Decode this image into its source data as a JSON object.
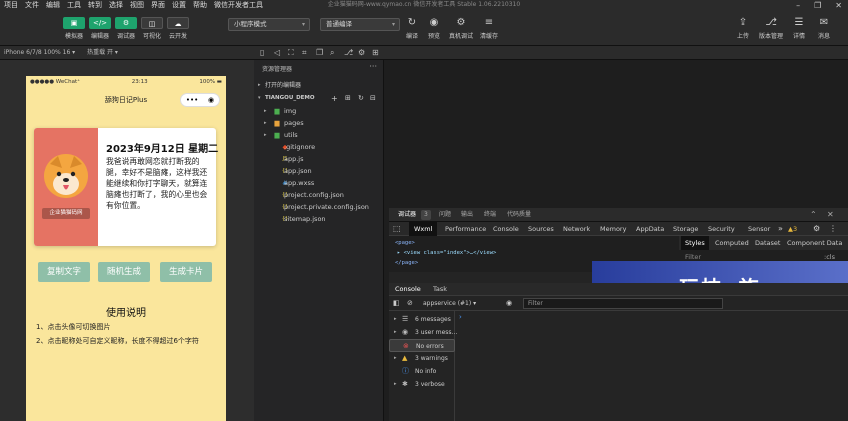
{
  "menu": [
    "项目",
    "文件",
    "编辑",
    "工具",
    "转到",
    "选择",
    "视图",
    "界面",
    "设置",
    "帮助",
    "微信开发者工具"
  ],
  "window_title": "企业猫猫码网-www.qymao.cn    微信开发者工具 Stable 1.06.2210310",
  "toolbar": {
    "buttons": [
      {
        "label": "模拟器",
        "glyph": "▣"
      },
      {
        "label": "编辑器",
        "glyph": "</>"
      },
      {
        "label": "调试器",
        "glyph": "⚙"
      },
      {
        "label": "可视化",
        "glyph": "◫"
      },
      {
        "label": "云开发",
        "glyph": "☁"
      }
    ],
    "mode_select": "小程序模式",
    "compile_select": "普通编译",
    "actions": [
      {
        "label": "编译",
        "glyph": "↻"
      },
      {
        "label": "预览",
        "glyph": "◉"
      },
      {
        "label": "真机调试",
        "glyph": "⚙"
      },
      {
        "label": "清缓存",
        "glyph": "≡"
      }
    ],
    "right_actions": [
      {
        "label": "上传",
        "glyph": "⇪"
      },
      {
        "label": "版本管理",
        "glyph": "⎇"
      },
      {
        "label": "详情",
        "glyph": "☰"
      },
      {
        "label": "消息",
        "glyph": "✉"
      }
    ]
  },
  "subbar": {
    "device": "iPhone 6/7/8 100% 16 ▾",
    "hot_reload": "热重载 开 ▾"
  },
  "phone": {
    "status_left": "●●●●● WeChat⁺",
    "time": "23:13",
    "battery": "100% ▬",
    "nav_title": "舔狗日记Plus",
    "capsule_dots": "•••",
    "capsule_target": "◉",
    "date": "2023年9月12日 星期二",
    "body": "我爸说再敢网恋就打断我的腿，幸好不是脑瘫，这样我还能继续和你打字聊天，就算连脑瘫也打断了，我的心里也会有你位置。",
    "badge": "企业猫猫码网",
    "buttons": [
      "复制文字",
      "随机生成",
      "生成卡片"
    ],
    "instructions_title": "使用说明",
    "instructions": [
      "1、点击头像可切换图片",
      "2、点击昵称处可自定义昵称，长度不得超过6个字符"
    ]
  },
  "explorer": {
    "title": "资源管理器",
    "dots": "···",
    "open_editors": "打开的编辑器",
    "project": "TIANGOU_DEMO",
    "items": [
      {
        "name": "img",
        "type": "folder",
        "icon": "▆",
        "color": "#4caf50"
      },
      {
        "name": "pages",
        "type": "folder",
        "icon": "▆",
        "color": "#e8a33d"
      },
      {
        "name": "utils",
        "type": "folder",
        "icon": "▆",
        "color": "#4caf50"
      },
      {
        "name": ".gitignore",
        "type": "file",
        "icon": "◆",
        "color": "#e44d26"
      },
      {
        "name": "app.js",
        "type": "file",
        "icon": "JS",
        "color": "#e8d44d"
      },
      {
        "name": "app.json",
        "type": "file",
        "icon": "{}",
        "color": "#e8d44d"
      },
      {
        "name": "app.wxss",
        "type": "file",
        "icon": "#",
        "color": "#42a5f5"
      },
      {
        "name": "project.config.json",
        "type": "file",
        "icon": "{}",
        "color": "#e8d44d"
      },
      {
        "name": "project.private.config.json",
        "type": "file",
        "icon": "{}",
        "color": "#e8d44d"
      },
      {
        "name": "sitemap.json",
        "type": "file",
        "icon": "{}",
        "color": "#e8d44d"
      }
    ]
  },
  "devtools": {
    "top_tabs": [
      "调试器",
      "3",
      "问题",
      "输出",
      "终端",
      "代码质量"
    ],
    "tabs": [
      "Wxml",
      "Performance",
      "Console",
      "Sources",
      "Network",
      "Memory",
      "AppData",
      "Storage",
      "Security",
      "Sensor"
    ],
    "more": "»",
    "warn_count": "▲3",
    "wxml_lines": [
      "<page>",
      "▸ <view class=\"index\">…</view>",
      "</page>"
    ],
    "styles_tabs": [
      "Styles",
      "Computed",
      "Dataset",
      "Component Data"
    ],
    "filter_label": "Filter",
    "filter_hint": ":cls",
    "console_tabs": [
      "Console",
      "Task"
    ],
    "context": "appservice (#1)",
    "filter_placeholder": "Filter",
    "sidebar": [
      {
        "label": "6 messages",
        "icon": "☰",
        "color": "#bbb"
      },
      {
        "label": "3 user mess...",
        "icon": "◉",
        "color": "#bbb"
      },
      {
        "label": "No errors",
        "icon": "⊗",
        "color": "#e05252"
      },
      {
        "label": "3 warnings",
        "icon": "▲",
        "color": "#e8b93d"
      },
      {
        "label": "No info",
        "icon": "ⓘ",
        "color": "#4d9cff"
      },
      {
        "label": "3 verbose",
        "icon": "✱",
        "color": "#bbb"
      }
    ],
    "prompt": "›"
  },
  "watermark": "玩技e族"
}
